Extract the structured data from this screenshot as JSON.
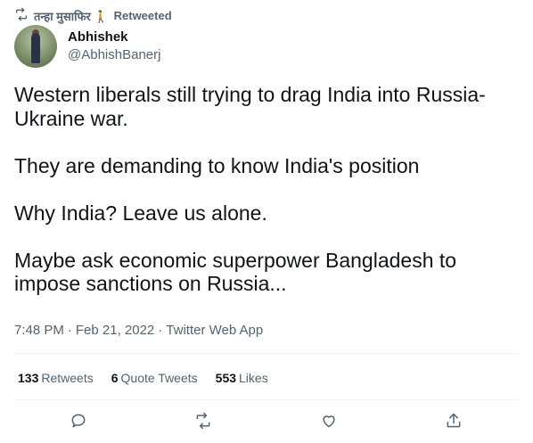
{
  "retweet_context": {
    "user": "तन्हा मुसाफिर 🚶",
    "label": "Retweeted"
  },
  "author": {
    "name": "Abhishek",
    "handle": "@AbhishBanerj"
  },
  "tweet": {
    "text": "Western liberals still trying to drag India into Russia-\nUkraine war.\n\nThey are demanding to know India's position\n\nWhy India? Leave us alone.\n\nMaybe ask economic superpower Bangladesh to\nimpose sanctions on Russia...",
    "time": "7:48 PM",
    "separator": "·",
    "date": "Feb 21, 2022",
    "source": "Twitter Web App"
  },
  "stats": {
    "retweets_count": "133",
    "retweets_label": "Retweets",
    "quotes_count": "6",
    "quotes_label": "Quote Tweets",
    "likes_count": "553",
    "likes_label": "Likes"
  },
  "icons": {
    "retweet": "retweet-icon",
    "reply": "reply-icon",
    "like": "heart-icon",
    "share": "share-icon"
  },
  "colors": {
    "text": "#0f1419",
    "secondary": "#536471",
    "divider": "#eff3f4"
  }
}
